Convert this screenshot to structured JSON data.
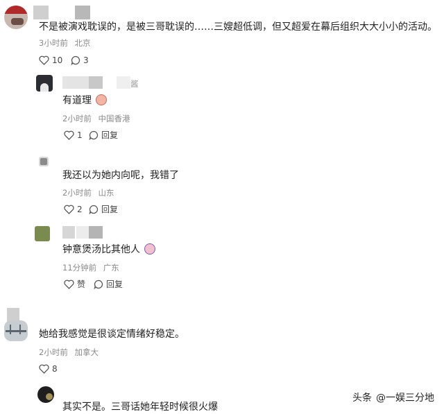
{
  "comments": [
    {
      "text": "不是被演戏耽误的，是被三哥耽误的……三嫂超低调，但又超爱在幕后组织大大小小的活动。",
      "time": "3小时前",
      "location": "北京",
      "likes": "10",
      "replies": "3"
    },
    {
      "username_tail": "酱",
      "text": "有道理",
      "time": "2小时前",
      "location": "中国香港",
      "likes": "1",
      "reply_label": "回复"
    },
    {
      "text": "我还以为她内向呢，我错了",
      "time": "2小时前",
      "location": "山东",
      "likes": "2",
      "reply_label": "回复"
    },
    {
      "text": "钟意煲汤比其他人",
      "time": "11分钟前",
      "location": "广东",
      "like_label": "赞",
      "reply_label": "回复"
    },
    {
      "text": "她给我感觉是很谈定情绪好稳定。",
      "time": "2小时前",
      "location": "加拿大",
      "likes": "8"
    },
    {
      "text": "其实不是。三哥话她年轻时候很火爆"
    }
  ],
  "watermark": {
    "platform": "头条",
    "account": "@一娱三分地"
  }
}
